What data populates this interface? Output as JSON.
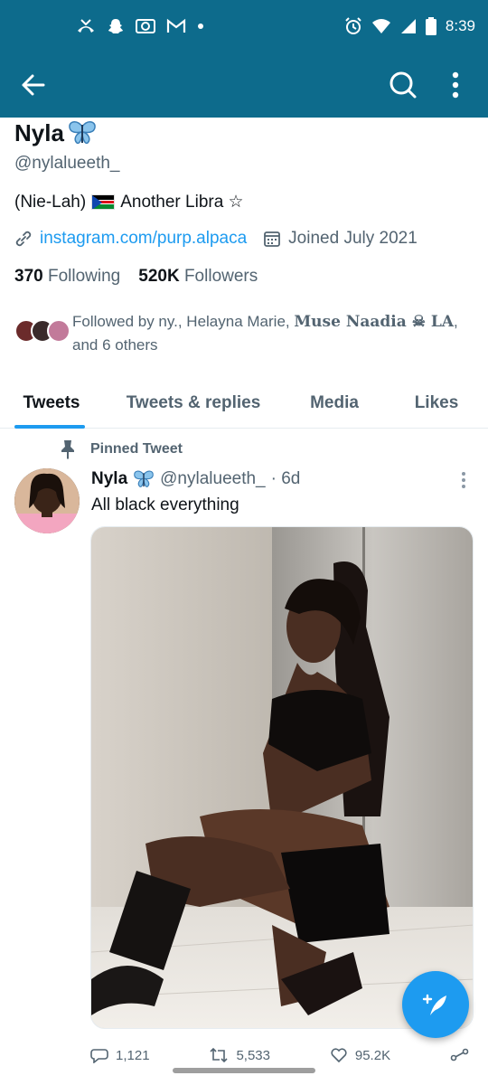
{
  "status_bar": {
    "time": "8:39",
    "left_icons": [
      "missed-call-icon",
      "snapchat-icon",
      "camera-icon",
      "gmail-icon",
      "dot-icon"
    ],
    "right_icons": [
      "alarm-icon",
      "wifi-icon",
      "signal-icon",
      "battery-icon"
    ]
  },
  "app_bar": {
    "icons": [
      "back-arrow-icon",
      "search-icon",
      "more-vertical-icon"
    ]
  },
  "profile": {
    "name": "Nyla",
    "name_emoji": "butterfly",
    "handle": "@nylalueeth_",
    "bio_prefix": "(Nie-Lah)",
    "bio_suffix": "Another Libra ☆",
    "link": "instagram.com/purp.alpaca",
    "joined": "Joined July 2021",
    "following_count": "370",
    "following_label": "Following",
    "followers_count": "520K",
    "followers_label": "Followers",
    "followed_by_prefix": "Followed by ny., Helayna Marie,",
    "followed_by_serif": "Muse Naadia ☠ LA",
    "followed_by_suffix": ", and 6 others"
  },
  "tabs": [
    {
      "label": "Tweets",
      "active": true
    },
    {
      "label": "Tweets & replies",
      "active": false
    },
    {
      "label": "Media",
      "active": false
    },
    {
      "label": "Likes",
      "active": false
    }
  ],
  "tweet": {
    "pinned_label": "Pinned Tweet",
    "author": "Nyla",
    "handle": "@nylalueeth_",
    "age": "· 6d",
    "text": "All black everything",
    "replies": "1,121",
    "retweets": "5,533",
    "likes": "95.2K"
  },
  "colors": {
    "header": "#0d6b8c",
    "accent": "#1d9bf0",
    "muted": "#536471"
  }
}
